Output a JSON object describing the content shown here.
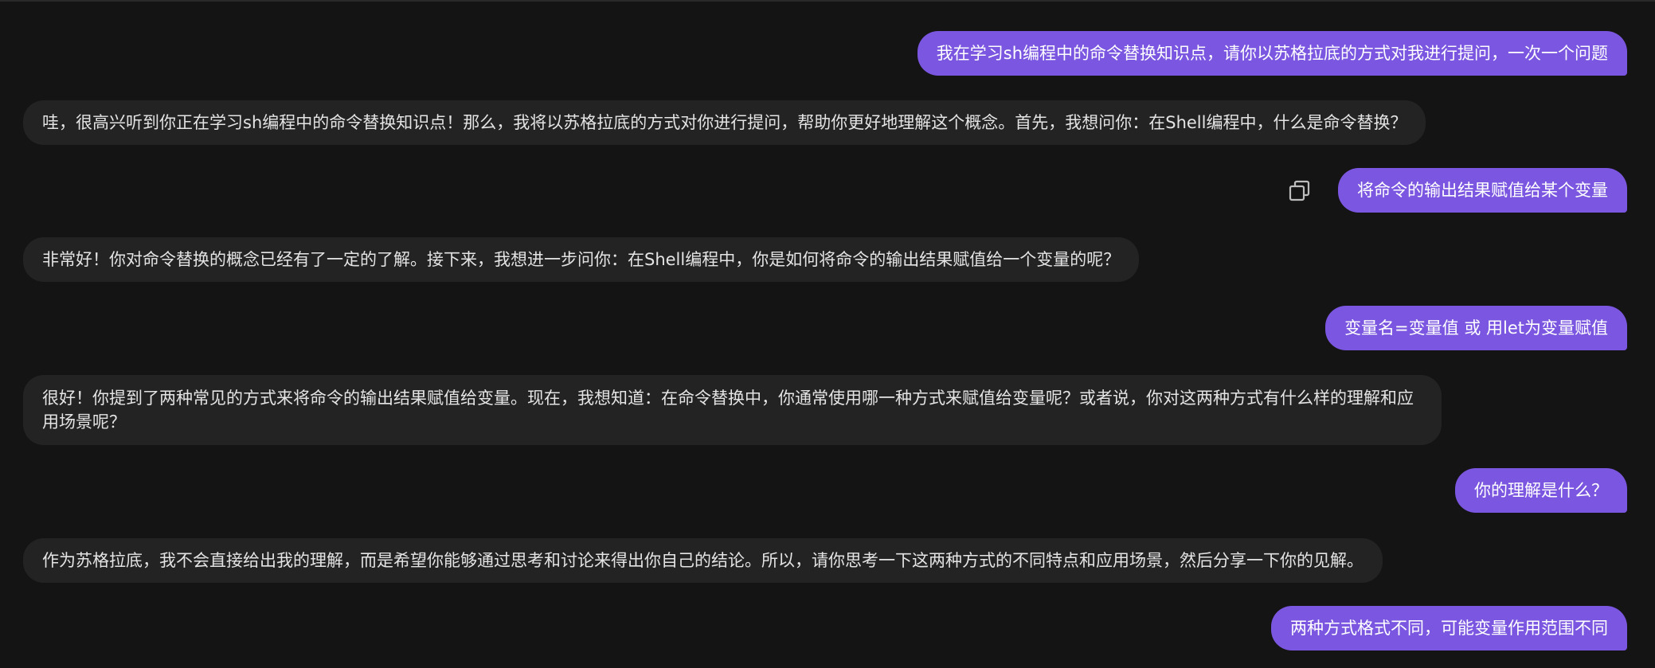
{
  "messages": [
    {
      "role": "user",
      "text": "我在学习sh编程中的命令替换知识点，请你以苏格拉底的方式对我进行提问，一次一个问题"
    },
    {
      "role": "assistant",
      "text": "哇，很高兴听到你正在学习sh编程中的命令替换知识点！那么，我将以苏格拉底的方式对你进行提问，帮助你更好地理解这个概念。首先，我想问你：在Shell编程中，什么是命令替换？"
    },
    {
      "role": "user",
      "text": "将命令的输出结果赋值给某个变量"
    },
    {
      "role": "assistant",
      "text": "非常好！你对命令替换的概念已经有了一定的了解。接下来，我想进一步问你：在Shell编程中，你是如何将命令的输出结果赋值给一个变量的呢？"
    },
    {
      "role": "user",
      "text": "变量名=变量值 或 用let为变量赋值"
    },
    {
      "role": "assistant",
      "text": "很好！你提到了两种常见的方式来将命令的输出结果赋值给变量。现在，我想知道：在命令替换中，你通常使用哪一种方式来赋值给变量呢？或者说，你对这两种方式有什么样的理解和应用场景呢？"
    },
    {
      "role": "user",
      "text": "你的理解是什么？"
    },
    {
      "role": "assistant",
      "text": "作为苏格拉底，我不会直接给出我的理解，而是希望你能够通过思考和讨论来得出你自己的结论。所以，请你思考一下这两种方式的不同特点和应用场景，然后分享一下你的见解。"
    },
    {
      "role": "user",
      "text": "两种方式格式不同，可能变量作用范围不同"
    }
  ],
  "icons": {
    "copy": "copy-icon"
  },
  "colors": {
    "user_bubble": "#7b56e0",
    "assistant_bubble": "#232323",
    "background": "#141414"
  }
}
